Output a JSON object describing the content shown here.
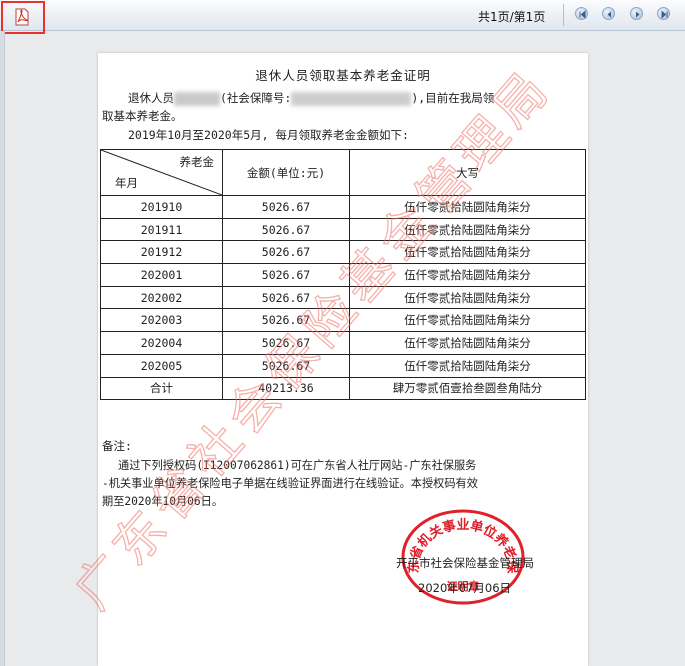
{
  "toolbar": {
    "pdf_icon": "pdf-icon",
    "page_info": "共1页/第1页",
    "nav": [
      "first-page-icon",
      "previous-page-icon",
      "next-page-icon",
      "last-page-icon"
    ]
  },
  "document": {
    "title": "退休人员领取基本养老金证明",
    "intro_prefix": "退休人员",
    "intro_mid": "(社会保障号:",
    "intro_suffix": "),目前在我局领",
    "intro_line2": "取基本养老金。",
    "period_line": "2019年10月至2020年5月, 每月领取养老金金额如下:",
    "table": {
      "header_top": "养老金",
      "header_bottom": "年月",
      "col_amount": "金额(单位:元)",
      "col_upper": "大写",
      "rows": [
        {
          "month": "201910",
          "amount": "5026.67",
          "upper": "伍仟零贰拾陆圆陆角柒分"
        },
        {
          "month": "201911",
          "amount": "5026.67",
          "upper": "伍仟零贰拾陆圆陆角柒分"
        },
        {
          "month": "201912",
          "amount": "5026.67",
          "upper": "伍仟零贰拾陆圆陆角柒分"
        },
        {
          "month": "202001",
          "amount": "5026.67",
          "upper": "伍仟零贰拾陆圆陆角柒分"
        },
        {
          "month": "202002",
          "amount": "5026.67",
          "upper": "伍仟零贰拾陆圆陆角柒分"
        },
        {
          "month": "202003",
          "amount": "5026.67",
          "upper": "伍仟零贰拾陆圆陆角柒分"
        },
        {
          "month": "202004",
          "amount": "5026.67",
          "upper": "伍仟零贰拾陆圆陆角柒分"
        },
        {
          "month": "202005",
          "amount": "5026.67",
          "upper": "伍仟零贰拾陆圆陆角柒分"
        }
      ],
      "total": {
        "month": "合计",
        "amount": "40213.36",
        "upper": "肆万零贰佰壹拾叁圆叁角陆分"
      }
    },
    "note_label": "备注:",
    "note_line1": "通过下列授权码(I12007062861)可在广东省人社厅网站-广东社保服务",
    "note_line2": "-机关事业单位养老保险电子单据在线验证界面进行在线验证。本授权码有效",
    "note_line3": "期至2020年10月06日。",
    "issuer": "开平市社会保险基金管理局",
    "date": "2020年07月06日",
    "stamp_text": "东省机关事业单位养老保",
    "stamp_sub": "证明章",
    "watermark": "广东省社会保险基金管理局",
    "stamp_color": "#e0202a"
  }
}
